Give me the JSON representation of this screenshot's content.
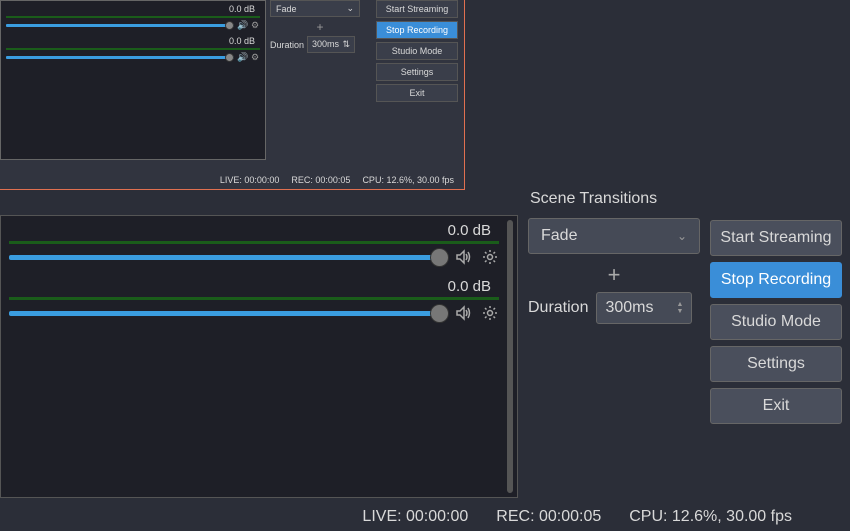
{
  "preview": {
    "mixer": {
      "tracks": [
        {
          "db": "0.0 dB"
        },
        {
          "db": "0.0 dB"
        }
      ]
    },
    "transitions": {
      "selected": "Fade",
      "duration_label": "Duration",
      "duration_value": "300ms"
    },
    "buttons": {
      "start_streaming": "Start Streaming",
      "stop_recording": "Stop Recording",
      "studio_mode": "Studio Mode",
      "settings": "Settings",
      "exit": "Exit"
    },
    "status": {
      "live": "LIVE: 00:00:00",
      "rec": "REC: 00:00:05",
      "cpu": "CPU: 12.6%, 30.00 fps"
    }
  },
  "main": {
    "mixer": {
      "tracks": [
        {
          "db": "0.0 dB"
        },
        {
          "db": "0.0 dB"
        }
      ]
    },
    "transitions": {
      "title": "Scene Transitions",
      "selected": "Fade",
      "duration_label": "Duration",
      "duration_value": "300ms"
    },
    "buttons": {
      "start_streaming": "Start Streaming",
      "stop_recording": "Stop Recording",
      "studio_mode": "Studio Mode",
      "settings": "Settings",
      "exit": "Exit"
    },
    "status": {
      "live": "LIVE: 00:00:00",
      "rec": "REC: 00:00:05",
      "cpu": "CPU: 12.6%, 30.00 fps"
    }
  }
}
